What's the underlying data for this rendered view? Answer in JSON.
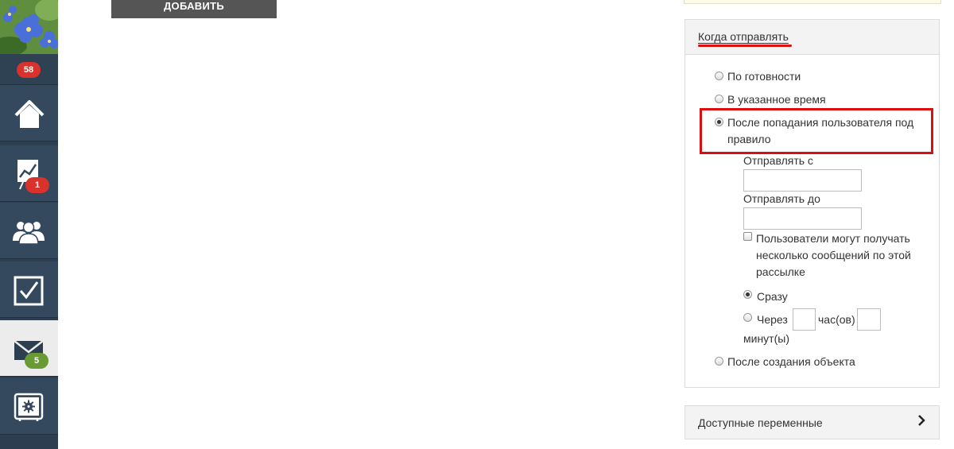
{
  "sidebar": {
    "notifications_badge": "58",
    "items": [
      {
        "name": "home",
        "badge": ""
      },
      {
        "name": "analytics",
        "badge": "1"
      },
      {
        "name": "users",
        "badge": ""
      },
      {
        "name": "tasks",
        "badge": ""
      },
      {
        "name": "mail",
        "badge": "5",
        "active": true
      },
      {
        "name": "safe-settings",
        "badge": ""
      }
    ],
    "colors": {
      "bg": "#34495e",
      "badge_red": "#d9322d",
      "badge_green": "#6a9a34"
    }
  },
  "toolbar": {
    "add_label": "ДОБАВИТЬ"
  },
  "send_panel": {
    "title": "Когда отправлять",
    "options": {
      "ready": "По готовности",
      "scheduled": "В указанное время",
      "after_rule": "После попадания пользователя под правило",
      "after_create": "После создания объекта"
    },
    "selected": "after_rule",
    "send_from_label": "Отправлять с",
    "send_from_value": "",
    "send_to_label": "Отправлять до",
    "send_to_value": "",
    "multi_label": "Пользователи могут получать несколько сообщений по этой рассылке",
    "multi_checked": false,
    "timing": {
      "immediately": "Сразу",
      "after": "Через",
      "hours": "час(ов)",
      "minutes": "минут(ы)",
      "hours_value": "",
      "minutes_value": "",
      "selected": "immediately"
    }
  },
  "vars_panel": {
    "title": "Доступные переменные"
  }
}
